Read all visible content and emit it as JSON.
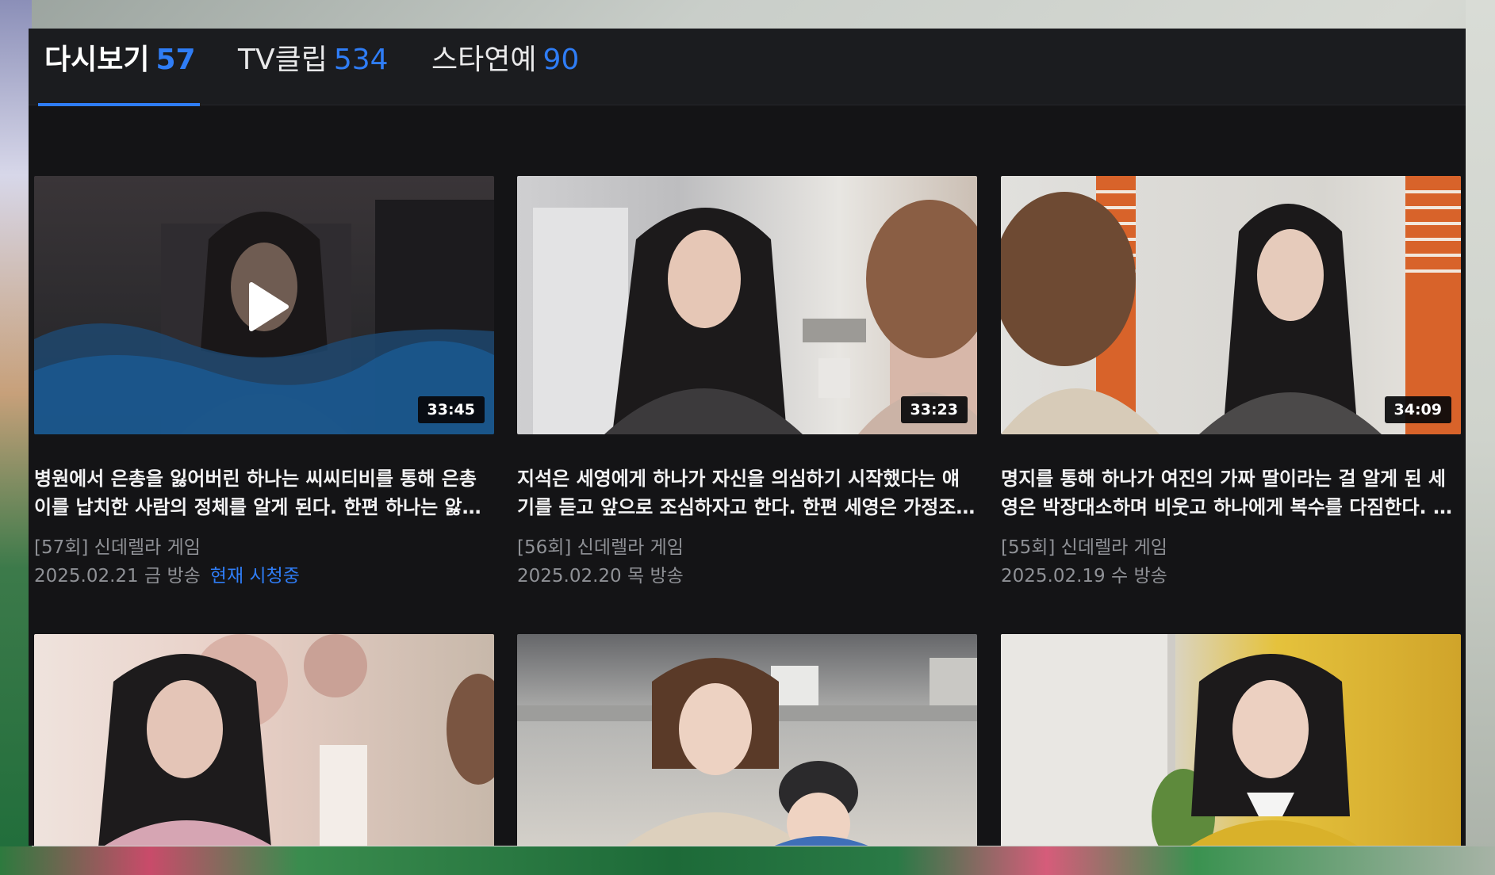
{
  "tabs": [
    {
      "label": "다시보기",
      "count": "57",
      "active": true
    },
    {
      "label": "TV클립",
      "count": "534",
      "active": false
    },
    {
      "label": "스타연예",
      "count": "90",
      "active": false
    }
  ],
  "videos": [
    {
      "duration": "33:45",
      "title": "병원에서 은총을 잃어버린 하나는 씨씨티비를 통해 은총이를 납치한 사람의 정체를 알게 된다. 한편 하나는 앓아누운 여…",
      "episode": "[57회] 신데렐라 게임",
      "date": "2025.02.21 금 방송",
      "now_watching": "현재 시청중"
    },
    {
      "duration": "33:23",
      "title": "지석은 세영에게 하나가 자신을 의심하기 시작했다는 얘기를 듣고 앞으로 조심하자고 한다. 한편 세영은 가정조사방문을…",
      "episode": "[56회] 신데렐라 게임",
      "date": "2025.02.20 목 방송"
    },
    {
      "duration": "34:09",
      "title": "명지를 통해 하나가 여진의 가짜 딸이라는 걸 알게 된 세영은 박장대소하며 비웃고 하나에게 복수를 다짐한다. 한편 진구…",
      "episode": "[55회] 신데렐라 게임",
      "date": "2025.02.19 수 방송"
    }
  ],
  "colors": {
    "accent": "#2f7df6",
    "panel": "#141416",
    "tabbar": "#1b1c1f"
  },
  "icons": {
    "play": "play-icon"
  }
}
